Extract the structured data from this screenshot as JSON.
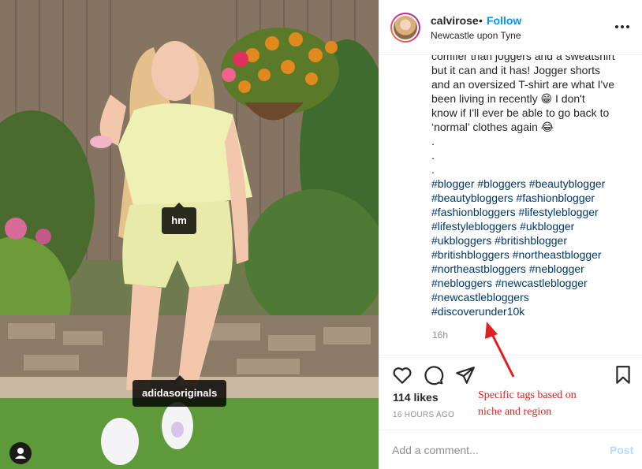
{
  "post": {
    "username": "calvirose",
    "separator": "•",
    "follow_label": "Follow",
    "location": "Newcastle upon Tyne",
    "caption_lines": [
      "comfier than joggers and a sweatshirt",
      "but it can and it has! Jogger shorts",
      "and an oversized T-shirt are what I've",
      "been living in recently 😁 I don't",
      "know if I'll ever be able to go back to",
      "‘normal’ clothes again 😂",
      ".",
      ".",
      "."
    ],
    "hashtag_lines": [
      [
        "#blogger",
        "#bloggers",
        "#beautyblogger"
      ],
      [
        "#beautybloggers",
        "#fashionblogger"
      ],
      [
        "#fashionbloggers",
        "#lifestyleblogger"
      ],
      [
        "#lifestylebloggers",
        "#ukblogger"
      ],
      [
        "#ukbloggers",
        "#britishblogger"
      ],
      [
        "#britishbloggers",
        "#northeastblogger"
      ],
      [
        "#northeastbloggers",
        "#neblogger"
      ],
      [
        "#nebloggers",
        "#newcastleblogger"
      ],
      [
        "#newcastlebloggers"
      ],
      [
        "#discoverunder10k"
      ]
    ],
    "time_ago": "16h",
    "likes": "114 likes",
    "date": "16 HOURS AGO"
  },
  "photo_tags": {
    "tag1": "hm",
    "tag2": "adidasoriginals"
  },
  "comment": {
    "placeholder": "Add a comment...",
    "post_label": "Post"
  },
  "annotation": {
    "line1": "Specific tags based on",
    "line2": "niche and region"
  },
  "colors": {
    "link": "#0095f6",
    "hashtag": "#00376b",
    "annotation": "#e02020",
    "muted": "#8e8e8e"
  },
  "icons": [
    "heart-icon",
    "comment-icon",
    "share-icon",
    "bookmark-icon",
    "more-options-icon",
    "user-tags-icon"
  ]
}
